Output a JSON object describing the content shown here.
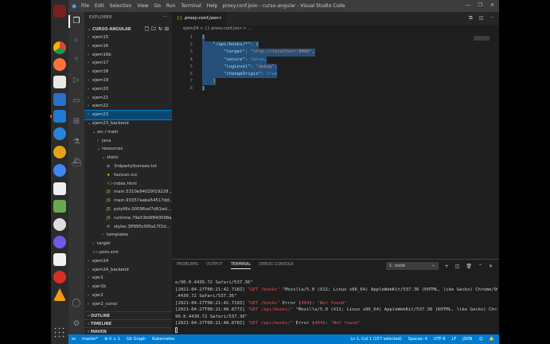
{
  "window": {
    "title": "proxy.conf.json - curso-angular - Visual Studio Code",
    "menu": [
      "File",
      "Edit",
      "Selection",
      "View",
      "Go",
      "Run",
      "Terminal",
      "Help"
    ]
  },
  "sidebar": {
    "header": "EXPLORER",
    "project": "CURSO-ANGULAR",
    "items": [
      {
        "label": "ejem15",
        "depth": 0,
        "type": "folder",
        "open": false
      },
      {
        "label": "ejem16",
        "depth": 0,
        "type": "folder",
        "open": false
      },
      {
        "label": "ejem16b",
        "depth": 0,
        "type": "folder",
        "open": false
      },
      {
        "label": "ejem17",
        "depth": 0,
        "type": "folder",
        "open": false
      },
      {
        "label": "ejem18",
        "depth": 0,
        "type": "folder",
        "open": false
      },
      {
        "label": "ejem19",
        "depth": 0,
        "type": "folder",
        "open": false
      },
      {
        "label": "ejem20",
        "depth": 0,
        "type": "folder",
        "open": false
      },
      {
        "label": "ejem21",
        "depth": 0,
        "type": "folder",
        "open": false
      },
      {
        "label": "ejem22",
        "depth": 0,
        "type": "folder",
        "open": false
      },
      {
        "label": "ejem23",
        "depth": 0,
        "type": "folder",
        "open": false,
        "selected": true
      },
      {
        "label": "ejem23_backend",
        "depth": 0,
        "type": "folder",
        "open": true
      },
      {
        "label": "src / main",
        "depth": 1,
        "type": "folder",
        "open": true
      },
      {
        "label": "java",
        "depth": 2,
        "type": "folder",
        "open": false
      },
      {
        "label": "resources",
        "depth": 2,
        "type": "folder",
        "open": true
      },
      {
        "label": "static",
        "depth": 3,
        "type": "folder",
        "open": true
      },
      {
        "label": "3rdpartylicenses.txt",
        "depth": 4,
        "type": "file",
        "icon": "txt"
      },
      {
        "label": "favicon.ico",
        "depth": 4,
        "type": "file",
        "icon": "star"
      },
      {
        "label": "index.html",
        "depth": 4,
        "type": "file",
        "icon": "html"
      },
      {
        "label": "main.5310e94029f19228...",
        "depth": 4,
        "type": "file",
        "icon": "js"
      },
      {
        "label": "main.93357aaba54517dd...",
        "depth": 4,
        "type": "file",
        "icon": "js"
      },
      {
        "label": "polyfills.00096ed7d91ed...",
        "depth": 4,
        "type": "file",
        "icon": "js"
      },
      {
        "label": "runtime.79e53b9f840098a...",
        "depth": 4,
        "type": "file",
        "icon": "js"
      },
      {
        "label": "styles.3ff995c0f0a17f2d...",
        "depth": 4,
        "type": "file",
        "icon": "css"
      },
      {
        "label": "templates",
        "depth": 3,
        "type": "folder",
        "open": false
      },
      {
        "label": "target",
        "depth": 1,
        "type": "folder",
        "open": false
      },
      {
        "label": "pom.xml",
        "depth": 1,
        "type": "file",
        "icon": "xml"
      },
      {
        "label": "ejem24",
        "depth": 0,
        "type": "folder",
        "open": false
      },
      {
        "label": "ejem24_backend",
        "depth": 0,
        "type": "folder",
        "open": false
      },
      {
        "label": "ejer1",
        "depth": 0,
        "type": "folder",
        "open": false
      },
      {
        "label": "ejer1b",
        "depth": 0,
        "type": "folder",
        "open": false
      },
      {
        "label": "ejer2",
        "depth": 0,
        "type": "folder",
        "open": false
      },
      {
        "label": "ejer2_curso",
        "depth": 0,
        "type": "folder",
        "open": false
      }
    ],
    "sections": [
      "OUTLINE",
      "TIMELINE",
      "MAVEN"
    ]
  },
  "editor": {
    "tab": "proxy.conf.json",
    "breadcrumb": "ejem24 > {} proxy.conf.json > ...",
    "lines": [
      "{",
      "    \"/api/books/*\": {",
      "        \"target\": \"http://localhost:8080\",",
      "        \"secure\": false,",
      "        \"logLevel\": \"debug\",",
      "        \"changeOrigin\": true",
      "    }",
      "}"
    ]
  },
  "panel": {
    "tabs": [
      "PROBLEMS",
      "OUTPUT",
      "TERMINAL",
      "DEBUG CONSOLE"
    ],
    "active_tab": "TERMINAL",
    "terminal_select": "1: node",
    "terminal_lines": [
      "e/90.0.4430.72 Safari/537.36\"",
      "[2021-04-27T08:21:42.718Z] \"GET /books\" \"Mozilla/5.0 (X11; Linux x86_64) AppleWebKit/537.36 (KHTML, like Gecko) Chrome/90.0",
      ".4430.72 Safari/537.36\"",
      "[2021-04-27T08:21:42.719Z] \"GET /books\" Error (404): \"Not found\"",
      "[2021-04-27T08:21:48.877Z] \"GET /api/books/\" \"Mozilla/5.0 (X11; Linux x86_64) AppleWebKit/537.36 (KHTML, like Gecko) Chrome/",
      "90.0.4430.72 Safari/537.36\"",
      "[2021-04-27T08:21:48.878Z] \"GET /api/books/\" Error (404): \"Not found\""
    ]
  },
  "statusbar": {
    "left": [
      "master*",
      "⊗ 0  ⚠ 1",
      "Git Graph",
      "Kubernetes"
    ],
    "right": [
      "Ln 1, Col 1 (157 selected)",
      "Spaces: 4",
      "UTF-8",
      "LF",
      "JSON"
    ]
  },
  "colors": {
    "accent": "#007acc",
    "selection": "#094771",
    "error": "#f14c4c"
  }
}
